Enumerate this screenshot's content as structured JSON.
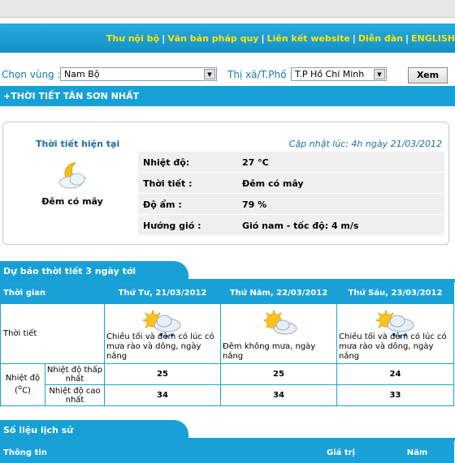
{
  "nav": {
    "links": [
      "Thư nội bộ",
      "Văn bản pháp quy",
      "Liên kết website",
      "Diễn đàn",
      "ENGLISH"
    ]
  },
  "filter": {
    "region_label": "Chọn vùng :",
    "region_value": "Nam Bộ",
    "city_label": "Thị xã/T.Phố :",
    "city_value": "T.P Hồ Chí Minh",
    "submit_label": "Xem"
  },
  "title": "+THỜI TIẾT  TÂN SƠN NHẤT",
  "current": {
    "heading": "Thời tiết hiện tại",
    "updated": "Cập nhật lúc: 4h ngày 21/03/2012",
    "icon": "moon-cloud-icon",
    "condition": "Đêm có mây",
    "rows": [
      {
        "key": "Nhiệt độ:",
        "value": "27 °C"
      },
      {
        "key": "Thời tiết :",
        "value": "Đêm có mây"
      },
      {
        "key": "Độ ẩm :",
        "value": "79 %"
      },
      {
        "key": "Hướng gió :",
        "value": "Gió nam - tốc độ: 4 m/s"
      }
    ]
  },
  "forecast": {
    "heading": "Dự báo thời tiết 3 ngày tới",
    "col_time": "Thời gian",
    "row_weather": "Thời tiết",
    "row_temp": "Nhiệt độ",
    "temp_unit_o": "o",
    "temp_unit_c": "C",
    "row_low": "Nhiệt độ thấp nhất",
    "row_high": "Nhiệt độ cao nhất",
    "days": [
      {
        "label": "Thứ Tư, 21/03/2012",
        "icon": "sun-cloud-rain-icon",
        "desc": "Chiều tối và đêm có lúc có mưa rào và dông, ngày nắng",
        "low": "25",
        "high": "34"
      },
      {
        "label": "Thứ Năm, 22/03/2012",
        "icon": "sun-cloud-icon",
        "desc": "Đêm không mưa, ngày nắng",
        "low": "25",
        "high": "34"
      },
      {
        "label": "Thứ Sáu, 23/03/2012",
        "icon": "sun-cloud-rain-icon",
        "desc": "Chiều tối và đêm có lúc có mưa rào và dông, ngày nắng",
        "low": "24",
        "high": "33"
      }
    ]
  },
  "history": {
    "heading": "Số liệu lịch sử",
    "cols": [
      "Thông tin",
      "Giá trị",
      "Năm"
    ]
  },
  "colors": {
    "accent": "#17a0d6",
    "nav_link": "#ffe600",
    "label_blue": "#1a6fa8"
  }
}
